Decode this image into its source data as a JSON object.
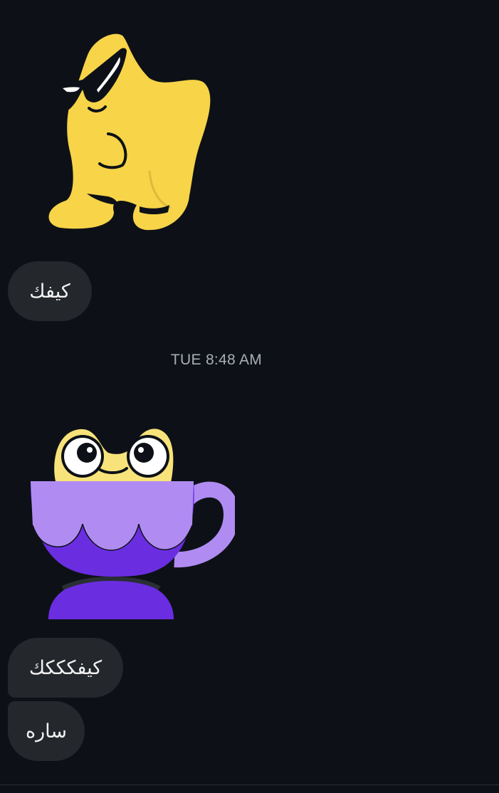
{
  "messages": [
    {
      "type": "sticker",
      "sticker": "star-sunglasses-sticker"
    },
    {
      "type": "text",
      "text": "كيفك"
    },
    {
      "type": "timestamp",
      "text": "TUE 8:48 AM"
    },
    {
      "type": "sticker",
      "sticker": "frog-in-cup-sticker"
    },
    {
      "type": "text",
      "text": "كيفكككك"
    },
    {
      "type": "text",
      "text": "ساره"
    }
  ],
  "colors": {
    "background": "#0d1117",
    "bubble": "#24272c",
    "bubble_text": "#f2f2f2",
    "timestamp": "#a9adb6",
    "star_yellow": "#f7d448",
    "cup_light": "#b08cf2",
    "cup_dark": "#6a2ee0"
  }
}
